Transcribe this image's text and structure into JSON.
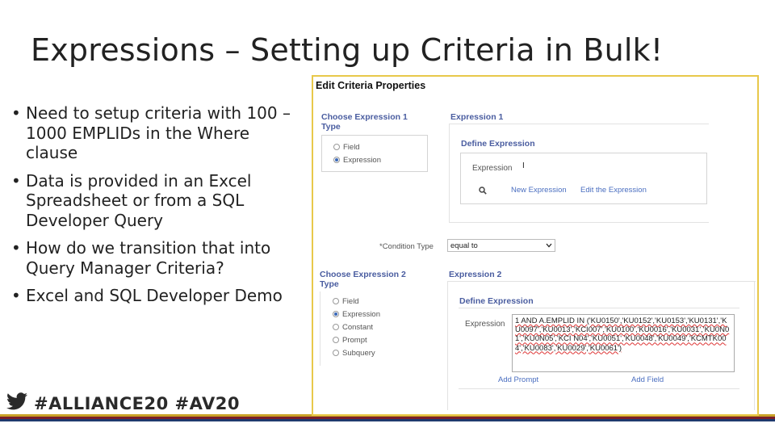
{
  "slide": {
    "title": "Expressions – Setting up Criteria in Bulk!",
    "bullets": [
      "Need to setup criteria with 100 – 1000 EMPLIDs in the Where clause",
      "Data is provided in an Excel Spreadsheet or from a SQL Developer Query",
      "How do we transition that into Query Manager Criteria?",
      "Excel and SQL Developer Demo"
    ],
    "footer": "#ALLIANCE20 #AV20",
    "stripe_colors": [
      "#c9a227",
      "#7a1f2a",
      "#1f3a6e"
    ]
  },
  "panel": {
    "title": "Edit Criteria Properties",
    "expr1": {
      "choose_label": "Choose Expression 1 Type",
      "options": [
        "Field",
        "Expression"
      ],
      "selected": "Expression",
      "header": "Expression 1",
      "define_label": "Define Expression",
      "expression_label": "Expression",
      "expression_value": "I",
      "new_expression_link": "New Expression",
      "edit_expression_link": "Edit the Expression"
    },
    "condition": {
      "label": "*Condition Type",
      "value": "equal to"
    },
    "expr2": {
      "choose_label": "Choose Expression 2 Type",
      "options": [
        "Field",
        "Expression",
        "Constant",
        "Prompt",
        "Subquery"
      ],
      "selected": "Expression",
      "header": "Expression 2",
      "define_label": "Define Expression",
      "expression_label": "Expression",
      "expression_text": "1 AND A.EMPLID IN ('KU0150','KU0152','KU0153','KU0131','KU0097','KU0013','KCI007','KU0100','KU0016','KU0031','KU0N01','KU0N05','KCI N04','KU0051','KU0048','KU0049','KCMTK004','KU0083','KU0029','KU0061')",
      "add_prompt_link": "Add Prompt",
      "add_field_link": "Add Field"
    }
  }
}
